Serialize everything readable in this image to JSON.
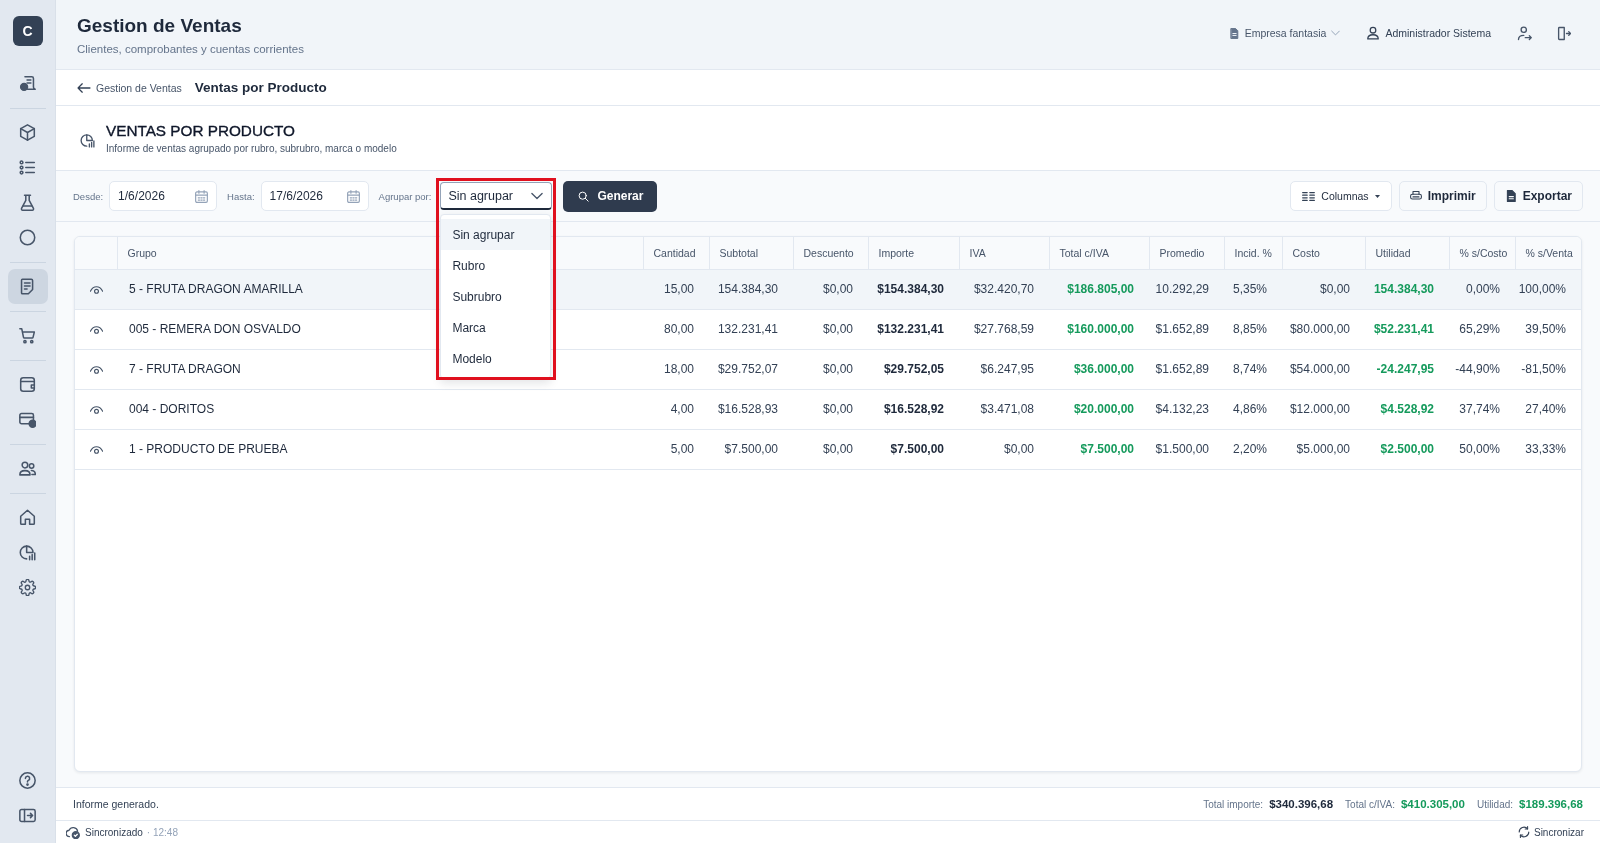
{
  "sidebar": {
    "logo": "C",
    "groups": [
      {
        "items": [
          {
            "kind": "billing",
            "selected": false
          }
        ]
      },
      {
        "items": [
          {
            "kind": "products",
            "selected": false
          },
          {
            "kind": "list",
            "selected": false
          },
          {
            "kind": "lab",
            "selected": false
          },
          {
            "kind": "circle",
            "selected": false
          }
        ]
      },
      {
        "items": [
          {
            "kind": "reports",
            "selected": true
          }
        ]
      },
      {
        "items": [
          {
            "kind": "cart",
            "selected": false
          }
        ]
      },
      {
        "items": [
          {
            "kind": "wallet",
            "selected": false
          },
          {
            "kind": "payments",
            "selected": false
          }
        ]
      },
      {
        "items": [
          {
            "kind": "people",
            "selected": false
          }
        ]
      },
      {
        "items": [
          {
            "kind": "home",
            "selected": false
          },
          {
            "kind": "analytics",
            "selected": false
          },
          {
            "kind": "settings",
            "selected": false
          }
        ]
      }
    ],
    "bottom_items": [
      {
        "kind": "help",
        "selected": false
      },
      {
        "kind": "collapse",
        "selected": false
      }
    ]
  },
  "header": {
    "title": "Gestion de Ventas",
    "subtitle": "Clientes, comprobantes y cuentas corrientes",
    "company": "Empresa fantasia",
    "user": "Administrador Sistema"
  },
  "breadcrumb": {
    "parent": "Gestion de Ventas",
    "current": "Ventas por Producto"
  },
  "report": {
    "title": "VENTAS POR PRODUCTO",
    "subtitle": "Informe de ventas agrupado por rubro, subrubro, marca o modelo"
  },
  "filters": {
    "from": {
      "label": "Desde:",
      "value": "1/6/2026"
    },
    "to": {
      "label": "Hasta:",
      "value": "17/6/2026"
    },
    "group_by": {
      "label": "Agrupar por:",
      "value": "Sin agrupar",
      "expanded": true,
      "highlighted": true,
      "options": [
        {
          "label": "Sin agrupar",
          "selected": true
        },
        {
          "label": "Rubro",
          "selected": false
        },
        {
          "label": "Subrubro",
          "selected": false
        },
        {
          "label": "Marca",
          "selected": false
        },
        {
          "label": "Modelo",
          "selected": false
        }
      ]
    },
    "generate_button": "Generar"
  },
  "actions": [
    {
      "kind": "columns",
      "label": "Columnas"
    },
    {
      "kind": "print",
      "label": "Imprimir"
    },
    {
      "kind": "export",
      "label": "Exportar"
    }
  ],
  "table": {
    "columns": [
      {
        "label": "Grupo",
        "kind": "text"
      },
      {
        "label": "Cantidad",
        "kind": "number"
      },
      {
        "label": "Subtotal",
        "kind": "number"
      },
      {
        "label": "Descuento",
        "kind": "number"
      },
      {
        "label": "Importe",
        "kind": "strong"
      },
      {
        "label": "IVA",
        "kind": "number"
      },
      {
        "label": "Total c/IVA",
        "kind": "accent"
      },
      {
        "label": "Promedio",
        "kind": "number"
      },
      {
        "label": "Incid. %",
        "kind": "number"
      },
      {
        "label": "Costo",
        "kind": "number"
      },
      {
        "label": "Utilidad",
        "kind": "accent"
      },
      {
        "label": "% s/Costo",
        "kind": "number"
      },
      {
        "label": "% s/Venta",
        "kind": "number"
      }
    ],
    "rows": [
      {
        "selected": true,
        "cells": [
          "5 - FRUTA DRAGON AMARILLA",
          "15,00",
          "154.384,30",
          "$0,00",
          "$154.384,30",
          "$32.420,70",
          "$186.805,00",
          "10.292,29",
          "5,35%",
          "$0,00",
          "154.384,30",
          "0,00%",
          "100,00%"
        ]
      },
      {
        "selected": false,
        "cells": [
          "005 - REMERA DON OSVALDO",
          "80,00",
          "132.231,41",
          "$0,00",
          "$132.231,41",
          "$27.768,59",
          "$160.000,00",
          "$1.652,89",
          "8,85%",
          "$80.000,00",
          "$52.231,41",
          "65,29%",
          "39,50%"
        ]
      },
      {
        "selected": false,
        "cells": [
          "7 - FRUTA DRAGON",
          "18,00",
          "$29.752,07",
          "$0,00",
          "$29.752,05",
          "$6.247,95",
          "$36.000,00",
          "$1.652,89",
          "8,74%",
          "$54.000,00",
          "-24.247,95",
          "-44,90%",
          "-81,50%"
        ]
      },
      {
        "selected": false,
        "cells": [
          "004 - DORITOS",
          "4,00",
          "$16.528,93",
          "$0,00",
          "$16.528,92",
          "$3.471,08",
          "$20.000,00",
          "$4.132,23",
          "4,86%",
          "$12.000,00",
          "$4.528,92",
          "37,74%",
          "27,40%"
        ]
      },
      {
        "selected": false,
        "cells": [
          "1 - PRODUCTO DE PRUEBA",
          "5,00",
          "$7.500,00",
          "$0,00",
          "$7.500,00",
          "$0,00",
          "$7.500,00",
          "$1.500,00",
          "2,20%",
          "$5.000,00",
          "$2.500,00",
          "50,00%",
          "33,33%"
        ]
      }
    ]
  },
  "summary": {
    "message": "Informe generado.",
    "totals": [
      {
        "label": "Total importe:",
        "value": "$340.396,68",
        "kind": "plain"
      },
      {
        "label": "Total c/IVA:",
        "value": "$410.305,00",
        "kind": "accent"
      },
      {
        "label": "Utilidad:",
        "value": "$189.396,68",
        "kind": "accent"
      }
    ]
  },
  "status_bar": {
    "sync_status": "Sincronizado",
    "time": "· 12:48",
    "sync_button": "Sincronizar"
  }
}
